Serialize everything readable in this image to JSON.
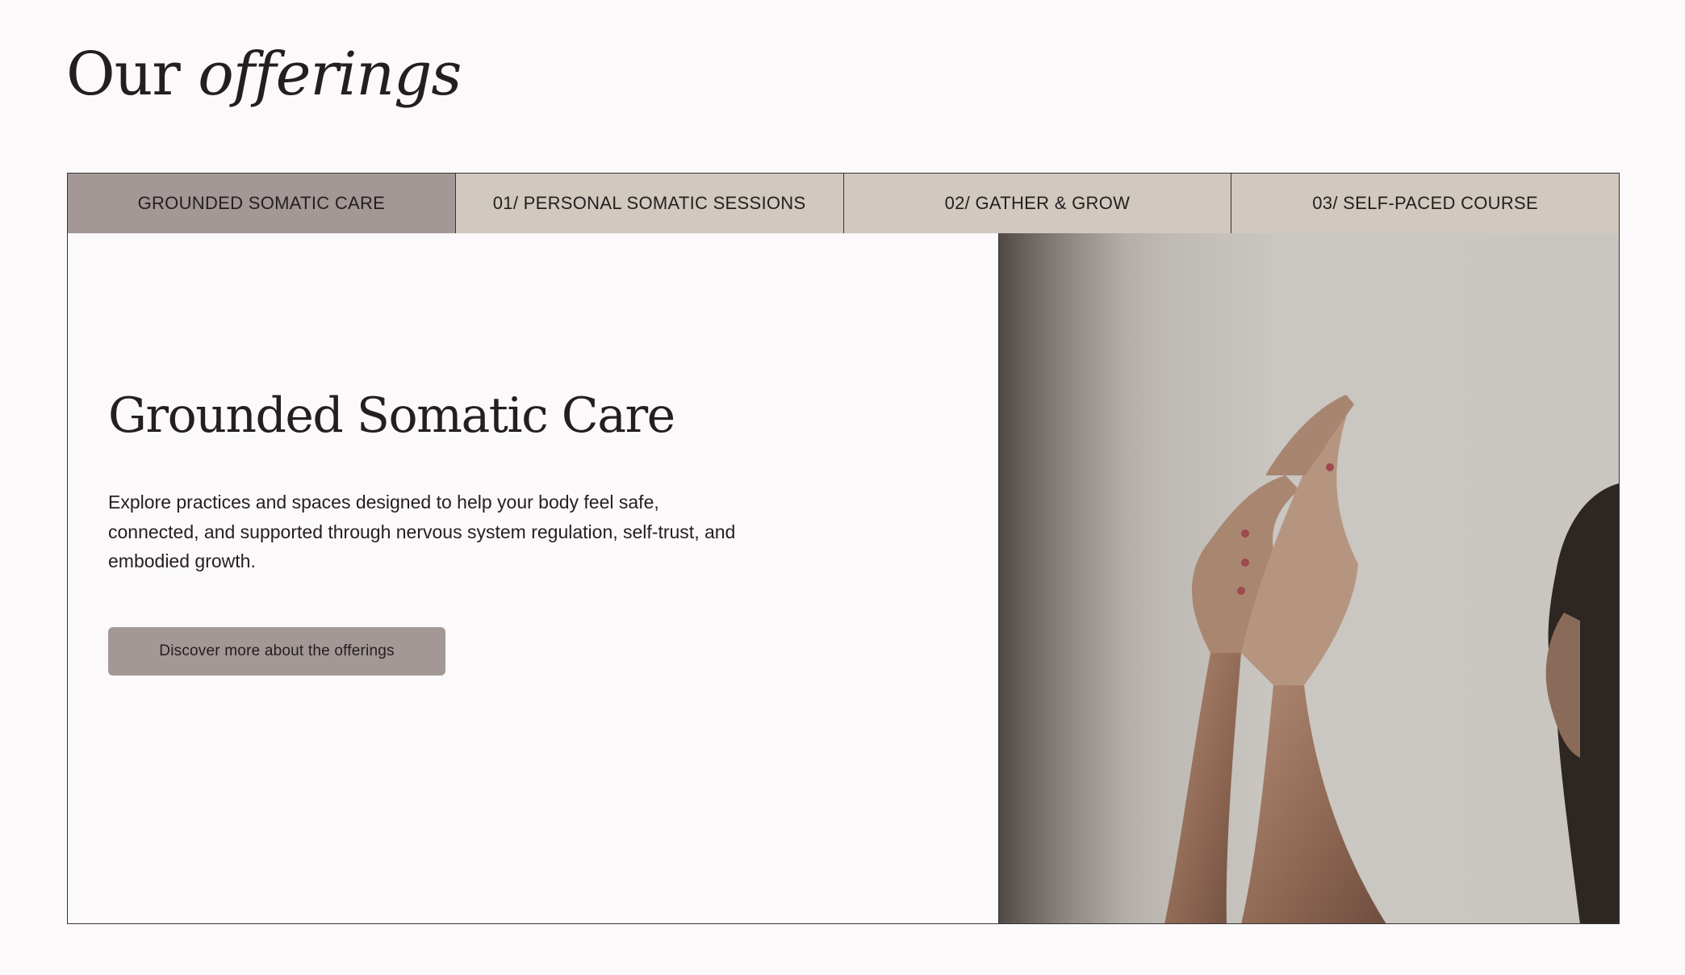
{
  "section": {
    "heading_part1": "Our",
    "heading_part2": "offerings"
  },
  "tabs": [
    {
      "label": "GROUNDED SOMATIC CARE",
      "active": true
    },
    {
      "label": "01/ PERSONAL SOMATIC SESSIONS",
      "active": false
    },
    {
      "label": "02/ GATHER & GROW",
      "active": false
    },
    {
      "label": "03/ SELF-PACED COURSE",
      "active": false
    }
  ],
  "panel": {
    "title": "Grounded Somatic Care",
    "description": "Explore practices and spaces designed to help your body feel safe, connected, and supported through nervous system regulation, self-trust, and embodied growth.",
    "cta_label": "Discover more about the offerings",
    "image_icon": "photo-raised-hands"
  },
  "colors": {
    "background": "#fbf9fa",
    "tab_inactive": "#d1c8c0",
    "tab_active": "#a39895",
    "button": "#a39895",
    "border": "#3a3433",
    "text": "#231f1e"
  }
}
